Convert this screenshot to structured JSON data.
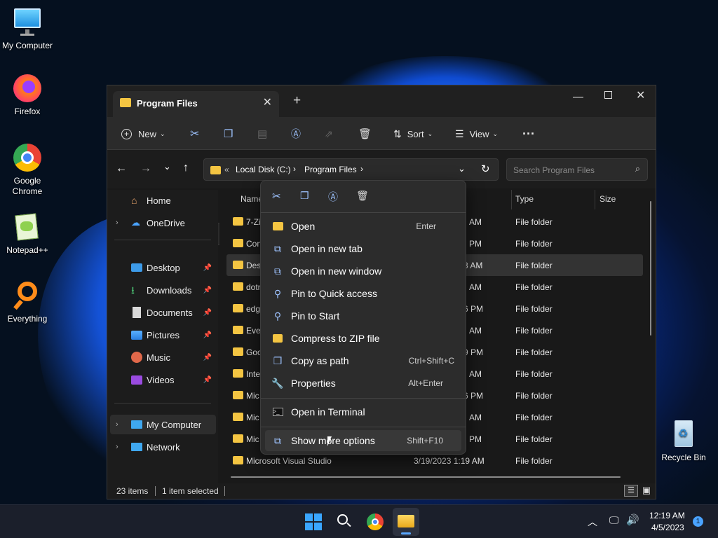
{
  "desktop": {
    "icons": [
      {
        "label": "My Computer",
        "icon": "monitor-icon"
      },
      {
        "label": "Firefox",
        "icon": "firefox-icon"
      },
      {
        "label": "Google\nChrome",
        "icon": "chrome-icon"
      },
      {
        "label": "Notepad++",
        "icon": "notepadpp-icon"
      },
      {
        "label": "Everything",
        "icon": "everything-icon"
      },
      {
        "label": "Recycle Bin",
        "icon": "recycle-bin-icon"
      }
    ]
  },
  "window": {
    "tab_title": "Program Files",
    "toolbar": {
      "new": "New",
      "sort": "Sort",
      "view": "View"
    },
    "address": {
      "crumb_prefix": "«",
      "crumb1": "Local Disk (C:)",
      "crumb2": "Program Files",
      "search_placeholder": "Search Program Files"
    },
    "nav": {
      "home": "Home",
      "onedrive": "OneDrive",
      "desktop": "Desktop",
      "downloads": "Downloads",
      "documents": "Documents",
      "pictures": "Pictures",
      "music": "Music",
      "videos": "Videos",
      "mycomputer": "My Computer",
      "network": "Network"
    },
    "columns": {
      "name": "Name",
      "type": "Type",
      "size": "Size"
    },
    "rows": [
      {
        "name": "7-Zi",
        "date": "AM",
        "type": "File folder"
      },
      {
        "name": "Con",
        "date": "PM",
        "type": "File folder"
      },
      {
        "name": "Desk",
        "date": "3 AM",
        "type": "File folder"
      },
      {
        "name": "dotn",
        "date": "AM",
        "type": "File folder"
      },
      {
        "name": "edg",
        "date": "6 PM",
        "type": "File folder"
      },
      {
        "name": "Ever",
        "date": "AM",
        "type": "File folder"
      },
      {
        "name": "Goo",
        "date": "9 PM",
        "type": "File folder"
      },
      {
        "name": "Inte",
        "date": "AM",
        "type": "File folder"
      },
      {
        "name": "Mic",
        "date": "6 PM",
        "type": "File folder"
      },
      {
        "name": "Mic",
        "date": "AM",
        "type": "File folder"
      },
      {
        "name": "Mic",
        "date": "PM",
        "type": "File folder"
      },
      {
        "name": "Microsoft Visual Studio",
        "date": "3/19/2023 1:19 AM",
        "type": "File folder"
      }
    ],
    "status": {
      "items": "23 items",
      "selected": "1 item selected"
    }
  },
  "context_menu": {
    "items": [
      {
        "label": "Open",
        "shortcut": "Enter"
      },
      {
        "label": "Open in new tab",
        "shortcut": ""
      },
      {
        "label": "Open in new window",
        "shortcut": ""
      },
      {
        "label": "Pin to Quick access",
        "shortcut": ""
      },
      {
        "label": "Pin to Start",
        "shortcut": ""
      },
      {
        "label": "Compress to ZIP file",
        "shortcut": ""
      },
      {
        "label": "Copy as path",
        "shortcut": "Ctrl+Shift+C"
      },
      {
        "label": "Properties",
        "shortcut": "Alt+Enter"
      },
      {
        "label": "Open in Terminal",
        "shortcut": ""
      },
      {
        "label": "Show more options",
        "shortcut": "Shift+F10"
      }
    ]
  },
  "taskbar": {
    "time": "12:19 AM",
    "date": "4/5/2023",
    "notification_count": "1"
  }
}
